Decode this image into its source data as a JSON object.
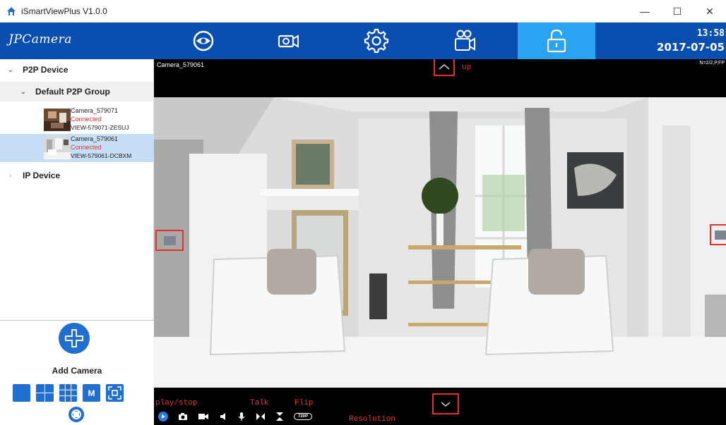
{
  "window": {
    "title": "iSmartViewPlus  V1.0.0",
    "minimize": "—",
    "maximize": "☐",
    "close": "✕"
  },
  "toolbar": {
    "logo": "JPCamera",
    "buttons": [
      {
        "icon": "eye-icon",
        "active": false
      },
      {
        "icon": "video-camera-icon",
        "active": false
      },
      {
        "icon": "gear-icon",
        "active": false
      },
      {
        "icon": "recording-icon",
        "active": false
      },
      {
        "icon": "lock-icon",
        "active": true
      }
    ],
    "time": "13:58",
    "date": "2017-07-05"
  },
  "sidebar": {
    "p2p_label": "P2P Device",
    "group_label": "Default P2P Group",
    "cameras": [
      {
        "name": "Camera_579071",
        "status": "Connected",
        "uid": "VIEW-579071-ZESUJ",
        "selected": false
      },
      {
        "name": "Camera_579061",
        "status": "Connected",
        "uid": "VIEW-579061-DCBXM",
        "selected": true
      }
    ],
    "ip_label": "IP Device",
    "add_camera": "Add Camera",
    "layout_m": "M"
  },
  "video": {
    "camera_title": "Camera_579061",
    "stats": "N=2/2,P,FP",
    "annotations": {
      "up": "up",
      "play_stop": "play/stop",
      "talk": "Talk",
      "flip": "Flip",
      "resolution": "Resolution"
    },
    "resolution_badge": "720P"
  },
  "colors": {
    "toolbar_bg": "#0a4fb0",
    "active_tab": "#2aa3f2",
    "accent": "#1e6fd0",
    "annotation_red": "#e53030",
    "status_red": "#e03a3a",
    "selected_row": "#c6dff7"
  }
}
